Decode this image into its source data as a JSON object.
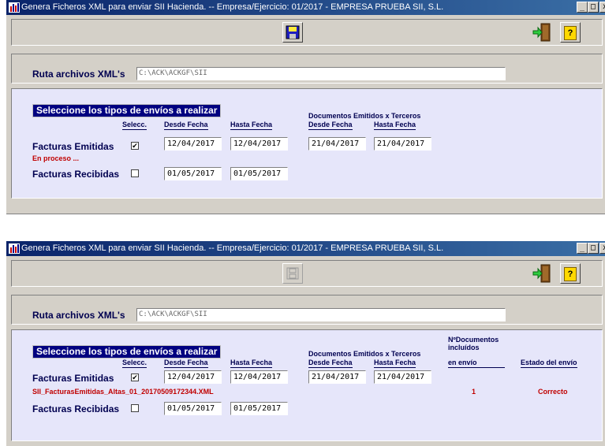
{
  "windows": [
    {
      "title": "Genera Ficheros XML para enviar SII Hacienda. -- Empresa/Ejercicio: 01/2017 - EMPRESA PRUEBA SII, S.L.",
      "path_label": "Ruta archivos XML's",
      "path_value": "C:\\ACK\\ACKGF\\SII",
      "section_title": "Seleccione los tipos de envíos a realizar",
      "headers": {
        "selecc": "Selecc.",
        "desde": "Desde Fecha",
        "hasta": "Hasta  Fecha",
        "terceros": "Documentos Emitidos x Terceros",
        "t_desde": "Desde Fecha",
        "t_hasta": "Hasta  Fecha"
      },
      "emitidas": {
        "label": "Facturas Emitidas",
        "checked": "✔",
        "desde": "12/04/2017",
        "hasta": "12/04/2017",
        "t_desde": "21/04/2017",
        "t_hasta": "21/04/2017",
        "status": "En proceso ..."
      },
      "recibidas": {
        "label": "Facturas Recibidas",
        "desde": "01/05/2017",
        "hasta": "01/05/2017"
      }
    },
    {
      "title": "Genera Ficheros XML para enviar SII Hacienda. -- Empresa/Ejercicio: 01/2017 - EMPRESA PRUEBA SII, S.L.",
      "path_label": "Ruta archivos XML's",
      "path_value": "C:\\ACK\\ACKGF\\SII",
      "section_title": "Seleccione los tipos de envíos a realizar",
      "headers": {
        "selecc": "Selecc.",
        "desde": "Desde Fecha",
        "hasta": "Hasta  Fecha",
        "terceros": "Documentos Emitidos x Terceros",
        "t_desde": "Desde Fecha",
        "t_hasta": "Hasta  Fecha",
        "ndocs_1": "NºDocumentos",
        "ndocs_2": "incluídos",
        "ndocs_3": "en envío",
        "estado": "Estado del envío"
      },
      "emitidas": {
        "label": "Facturas Emitidas",
        "checked": "✔",
        "desde": "12/04/2017",
        "hasta": "12/04/2017",
        "t_desde": "21/04/2017",
        "t_hasta": "21/04/2017",
        "file": "SII_FacturasEmitidas_Altas_01_20170509172344.XML",
        "count": "1",
        "estado": "Correcto"
      },
      "recibidas": {
        "label": "Facturas Recibidas",
        "desde": "01/05/2017",
        "hasta": "01/05/2017"
      }
    }
  ],
  "titlebar_buttons": {
    "minimize": "_",
    "maximize": "□",
    "close": "x"
  },
  "colors": {
    "title_bar": "#0a246a",
    "panel": "#e6e6fa",
    "label": "#000050",
    "status_red": "#c00000",
    "section_title_bg": "#000080"
  }
}
